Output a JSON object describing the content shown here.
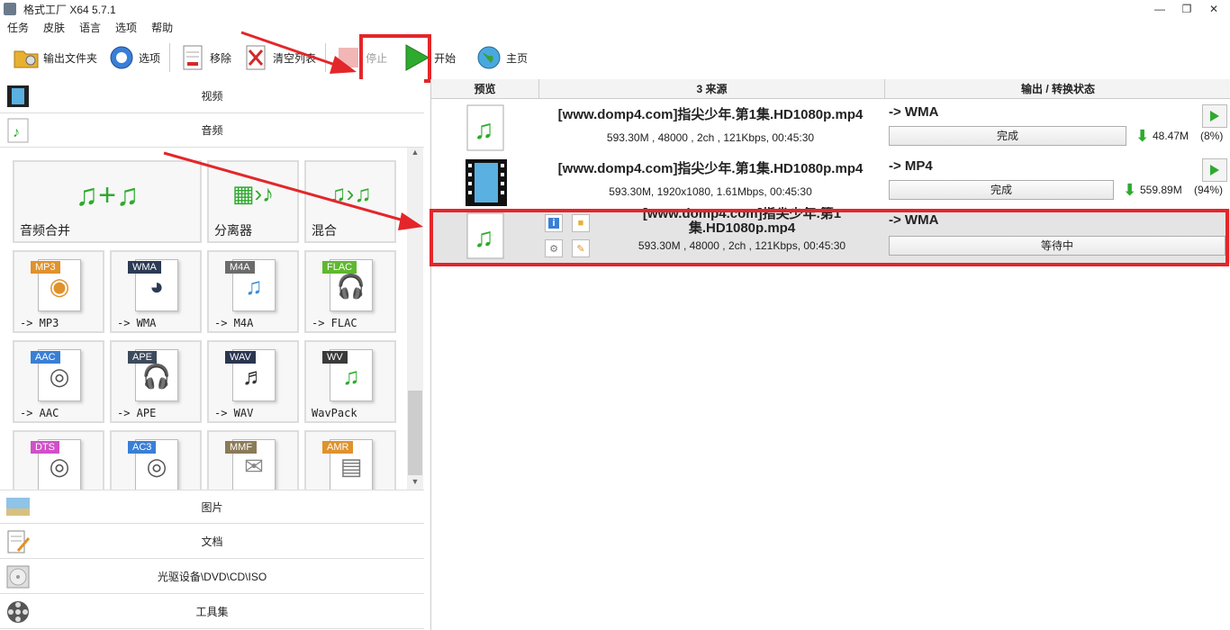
{
  "window": {
    "title": "格式工厂 X64 5.7.1",
    "buttons": [
      "—",
      "❐",
      "✕"
    ]
  },
  "menu": [
    "任务",
    "皮肤",
    "语言",
    "选项",
    "帮助"
  ],
  "toolbar": {
    "output_folder": "输出文件夹",
    "options": "选项",
    "remove": "移除",
    "clear_list": "清空列表",
    "stop": "停止",
    "start": "开始",
    "home": "主页"
  },
  "categories": {
    "video": "视频",
    "audio": "音频",
    "picture": "图片",
    "document": "文档",
    "disc": "光驱设备\\DVD\\CD\\ISO",
    "tools": "工具集"
  },
  "audio_tools": [
    {
      "label": "音频合并",
      "glyph": "♫+♫"
    },
    {
      "label": "分离器",
      "glyph": "▦›♪"
    },
    {
      "label": "混合",
      "glyph": "♫›♫"
    }
  ],
  "audio_formats": [
    {
      "badge": "MP3",
      "label": "-> MP3",
      "color": "#e0922b",
      "glyph": "◉"
    },
    {
      "badge": "WMA",
      "label": "-> WMA",
      "color": "#2b3a55",
      "glyph": "◕"
    },
    {
      "badge": "M4A",
      "label": "-> M4A",
      "color": "#6b6b6b",
      "glyph": "♫"
    },
    {
      "badge": "FLAC",
      "label": "-> FLAC",
      "color": "#5fb82f",
      "glyph": "🎧"
    },
    {
      "badge": "AAC",
      "label": "-> AAC",
      "color": "#3a7fd6",
      "glyph": "◎"
    },
    {
      "badge": "APE",
      "label": "-> APE",
      "color": "#3d4a5c",
      "glyph": "🎧"
    },
    {
      "badge": "WAV",
      "label": "-> WAV",
      "color": "#2b3550",
      "glyph": "♬"
    },
    {
      "badge": "WV",
      "label": "WavPack",
      "color": "#3a3a3a",
      "glyph": "♫"
    },
    {
      "badge": "DTS",
      "label": "",
      "color": "#d050c8",
      "glyph": "◎"
    },
    {
      "badge": "AC3",
      "label": "",
      "color": "#3a7fd6",
      "glyph": "◎"
    },
    {
      "badge": "MMF",
      "label": "",
      "color": "#8a7a55",
      "glyph": "✉"
    },
    {
      "badge": "AMR",
      "label": "",
      "color": "#e0922b",
      "glyph": "▤"
    }
  ],
  "list_header": {
    "preview": "预览",
    "source": "3 来源",
    "output": "输出 / 转换状态"
  },
  "tasks": [
    {
      "name": "[www.domp4.com]指尖少年.第1集.HD1080p.mp4",
      "info": "593.30M , 48000 , 2ch , 121Kbps, 00:45:30",
      "output": "-> WMA",
      "status": "完成",
      "size": "48.47M",
      "percent": "(8%)"
    },
    {
      "name": "[www.domp4.com]指尖少年.第1集.HD1080p.mp4",
      "info": "593.30M, 1920x1080, 1.61Mbps, 00:45:30",
      "output": "-> MP4",
      "status": "完成",
      "size": "559.89M",
      "percent": "(94%)"
    },
    {
      "name": "[www.domp4.com]指尖少年.第1集.HD1080p.mp4",
      "info": "593.30M , 48000 , 2ch , 121Kbps, 00:45:30",
      "output": "-> WMA",
      "status": "等待中"
    }
  ],
  "colors": {
    "accent_red": "#e3262a",
    "play_green": "#2eaa2e"
  }
}
